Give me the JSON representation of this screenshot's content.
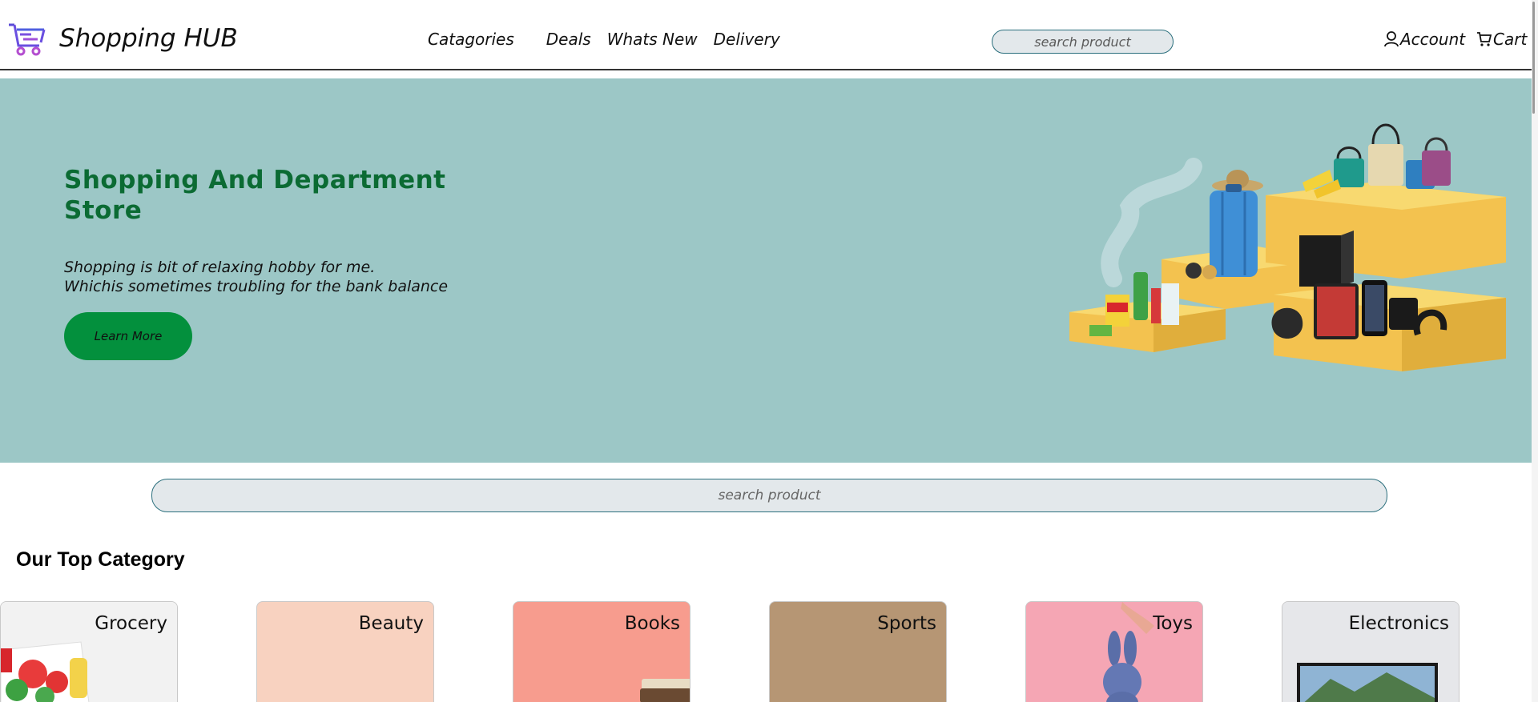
{
  "header": {
    "brand": "Shopping HUB",
    "logo_icon": "shopping-cart-logo-icon",
    "nav": [
      "Catagories",
      "Deals",
      "Whats New",
      "Delivery"
    ],
    "search_placeholder": "search product",
    "account_label": "Account",
    "cart_label": "Cart"
  },
  "hero": {
    "title": "Shopping And Department Store",
    "line1": "Shopping is bit of relaxing hobby for me.",
    "line2": "Whichis sometimes troubling for the bank balance",
    "button_label": "Learn More",
    "background_color": "#9cc7c6",
    "title_color": "#0b6b33",
    "button_color": "#03903d"
  },
  "search": {
    "placeholder": "search product"
  },
  "categories": {
    "title": "Our Top Category",
    "items": [
      {
        "label": "Grocery",
        "color": "#f2f2f2"
      },
      {
        "label": "Beauty",
        "color": "#f8d2c0"
      },
      {
        "label": "Books",
        "color": "#f79c8e"
      },
      {
        "label": "Sports",
        "color": "#b69674"
      },
      {
        "label": "Toys",
        "color": "#f5a6b4"
      },
      {
        "label": "Electronics",
        "color": "#e6e7ea"
      }
    ]
  }
}
